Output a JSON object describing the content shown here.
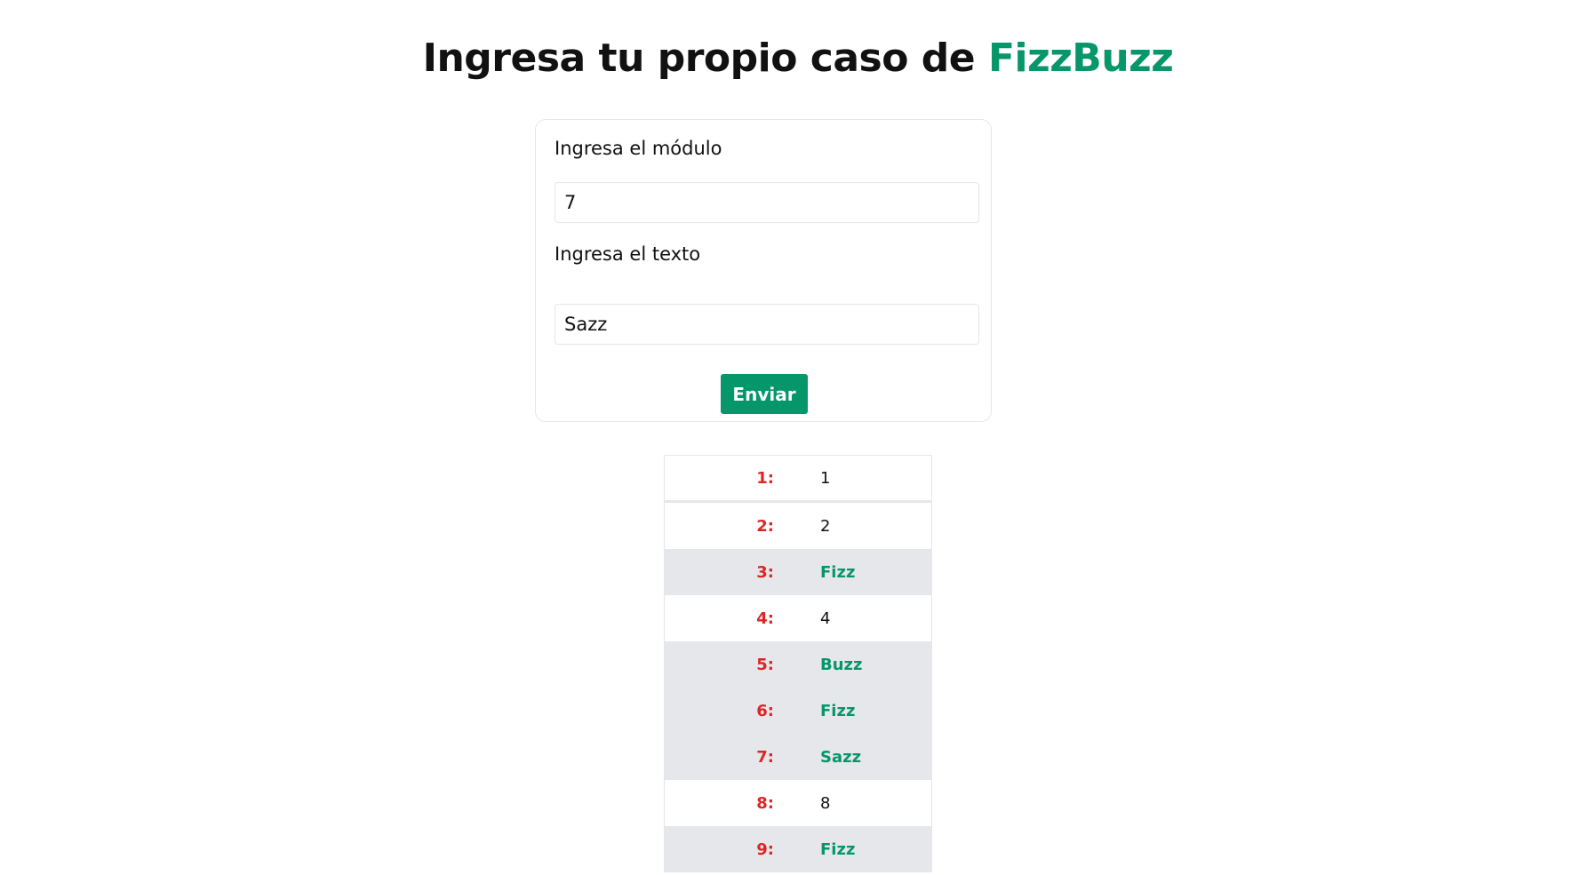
{
  "header": {
    "title_prefix": "Ingresa tu propio caso de",
    "title_accent": "FizzBuzz"
  },
  "form": {
    "module_label": "Ingresa el módulo",
    "module_value": "7",
    "text_label": "Ingresa el texto",
    "text_value": "Sazz",
    "submit_label": "Enviar"
  },
  "colors": {
    "accent": "#059669",
    "number": "#dc2626",
    "highlight_row": "#e5e7eb"
  },
  "results": [
    {
      "n": "1:",
      "value": "1",
      "word": false
    },
    {
      "n": "2:",
      "value": "2",
      "word": false
    },
    {
      "n": "3:",
      "value": "Fizz",
      "word": true
    },
    {
      "n": "4:",
      "value": "4",
      "word": false
    },
    {
      "n": "5:",
      "value": "Buzz",
      "word": true
    },
    {
      "n": "6:",
      "value": "Fizz",
      "word": true
    },
    {
      "n": "7:",
      "value": "Sazz",
      "word": true
    },
    {
      "n": "8:",
      "value": "8",
      "word": false
    },
    {
      "n": "9:",
      "value": "Fizz",
      "word": true
    }
  ]
}
